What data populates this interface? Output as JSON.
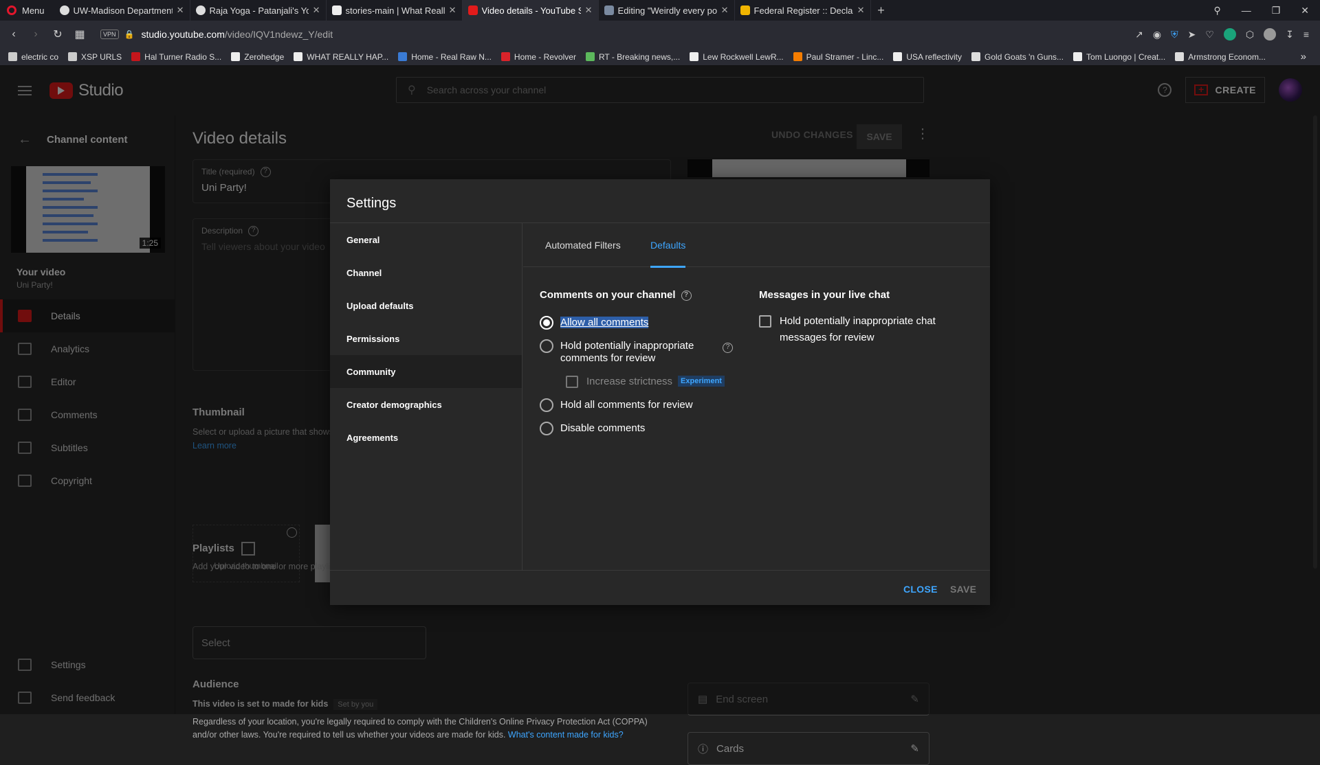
{
  "browser": {
    "menu_label": "Menu",
    "tabs": [
      {
        "title": "UW-Madison Department o",
        "icon": "globe-icon"
      },
      {
        "title": "Raja Yoga - Patanjali's Yoga",
        "icon": "globe-icon"
      },
      {
        "title": "stories-main | What Really H",
        "icon": "wrh-icon"
      },
      {
        "title": "Video details - YouTube Stu",
        "icon": "youtube-icon"
      },
      {
        "title": "Editing \"Weirdly every post",
        "icon": "image-icon"
      },
      {
        "title": "Federal Register :: Declarati",
        "icon": "fr-icon"
      }
    ],
    "vpn_label": "VPN",
    "url_host": "studio.youtube.com",
    "url_path": "/video/IQV1ndewz_Y/edit",
    "bookmarks": [
      {
        "label": "electric co",
        "color": "#cccccc"
      },
      {
        "label": "XSP URLS",
        "color": "#cccccc"
      },
      {
        "label": "Hal Turner Radio S...",
        "color": "#c4161c"
      },
      {
        "label": "Zerohedge",
        "color": "#eeeeee"
      },
      {
        "label": "WHAT REALLY HAP...",
        "color": "#eeeeee"
      },
      {
        "label": "Home - Real Raw N...",
        "color": "#3a7bd5"
      },
      {
        "label": "Home - Revolver",
        "color": "#d8232a"
      },
      {
        "label": "RT - Breaking news,...",
        "color": "#5cb85c"
      },
      {
        "label": "Lew Rockwell LewR...",
        "color": "#eeeeee"
      },
      {
        "label": "Paul Stramer - Linc...",
        "color": "#f57d00"
      },
      {
        "label": "USA reflectivity",
        "color": "#eeeeee"
      },
      {
        "label": "Gold Goats 'n Guns...",
        "color": "#dddddd"
      },
      {
        "label": "Tom Luongo | Creat...",
        "color": "#eeeeee"
      },
      {
        "label": "Armstrong Econom...",
        "color": "#dddddd"
      }
    ]
  },
  "studio": {
    "logo_text": "Studio",
    "search_placeholder": "Search across your channel",
    "create_label": "CREATE",
    "nav": {
      "back_label": "Channel content",
      "duration": "1:25",
      "your_video": "Your video",
      "video_title": "Uni Party!",
      "items": [
        {
          "label": "Details",
          "icon": "pencil-icon",
          "active": true
        },
        {
          "label": "Analytics",
          "icon": "analytics-icon"
        },
        {
          "label": "Editor",
          "icon": "editor-icon"
        },
        {
          "label": "Comments",
          "icon": "comments-icon"
        },
        {
          "label": "Subtitles",
          "icon": "subtitles-icon"
        },
        {
          "label": "Copyright",
          "icon": "copyright-icon"
        }
      ],
      "bottom": [
        {
          "label": "Settings",
          "icon": "gear-icon"
        },
        {
          "label": "Send feedback",
          "icon": "feedback-icon"
        }
      ]
    },
    "main": {
      "page_title": "Video details",
      "undo_label": "UNDO CHANGES",
      "save_label": "SAVE",
      "title_label": "Title (required)",
      "title_value": "Uni Party!",
      "desc_label": "Description",
      "desc_placeholder": "Tell viewers about your video",
      "thumb_heading": "Thumbnail",
      "thumb_text": "Select or upload a picture that shows",
      "learn_more": "Learn more",
      "upload_thumb": "Upload thumbnail",
      "playlists_heading": "Playlists",
      "playlists_text": "Add your video to one or more playlists",
      "select_label": "Select",
      "audience_heading": "Audience",
      "audience_line": "This video is set to made for kids",
      "set_by": "Set by you",
      "coppa_text": "Regardless of your location, you're legally required to comply with the Children's Online Privacy Protection Act (COPPA) and/or other laws. You're required to tell us whether your videos are made for kids.",
      "coppa_link": "What's content made for kids?",
      "end_screen": "End screen",
      "cards": "Cards"
    }
  },
  "modal": {
    "title": "Settings",
    "sidebar": [
      {
        "label": "General"
      },
      {
        "label": "Channel"
      },
      {
        "label": "Upload defaults"
      },
      {
        "label": "Permissions"
      },
      {
        "label": "Community",
        "active": true
      },
      {
        "label": "Creator demographics"
      },
      {
        "label": "Agreements"
      }
    ],
    "tabs": [
      {
        "label": "Automated Filters"
      },
      {
        "label": "Defaults",
        "active": true
      }
    ],
    "comments_heading": "Comments on your channel",
    "options": {
      "allow_all": "Allow all comments",
      "hold_inappropriate": "Hold potentially inappropriate comments for review",
      "increase_strictness": "Increase strictness",
      "experiment_badge": "Experiment",
      "hold_all": "Hold all comments for review",
      "disable": "Disable comments"
    },
    "selected_option": "allow_all",
    "live_chat_heading": "Messages in your live chat",
    "live_chat_option": "Hold potentially inappropriate chat messages for review",
    "close_label": "CLOSE",
    "save_label": "SAVE"
  },
  "colors": {
    "accent": "#3ea6ff",
    "brand_red": "#e21b1b"
  }
}
